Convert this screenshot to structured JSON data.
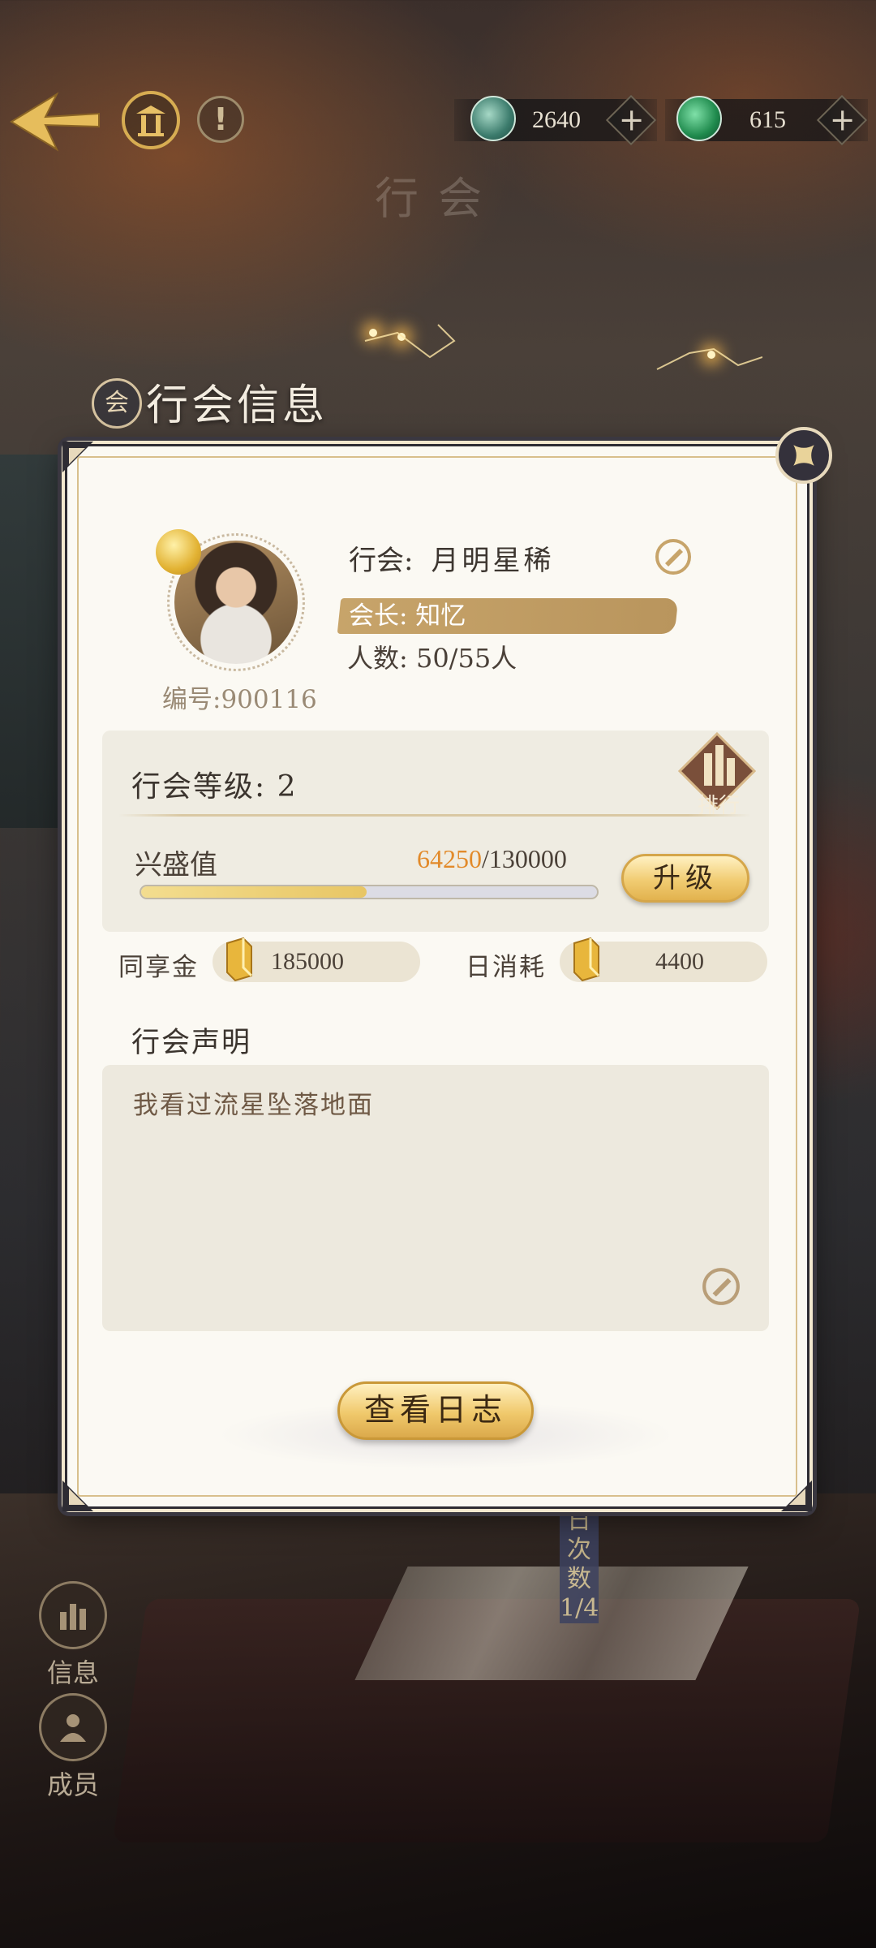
{
  "topbar": {
    "currencies": [
      {
        "icon": "jade-coin-icon",
        "value": "2640",
        "plus": "+"
      },
      {
        "icon": "jade-ring-icon",
        "value": "615",
        "plus": "+"
      }
    ],
    "info_glyph": "!"
  },
  "background": {
    "banner_title": "行会",
    "scroll_text": "日次数 1/4"
  },
  "panel": {
    "title": "行会信息",
    "title_icon_glyph": "会",
    "guild_label": "行会:",
    "guild_name": "月明星稀",
    "leader": "会长: 知忆",
    "member_count": "人数: 50/55人",
    "id_label": "编号:900116",
    "level_label": "行会等级: 2",
    "rank_label": "排行",
    "prosperity_label": "兴盛值",
    "prosperity_current": "64250",
    "prosperity_max": "/130000",
    "prosperity_progress": 0.494,
    "upgrade_button": "升级",
    "shared_fund_label": "同享金",
    "shared_fund_value": "185000",
    "daily_cost_label": "日消耗",
    "daily_cost_value": "4400",
    "declaration_title": "行会声明",
    "declaration_text": "我看过流星坠落地面",
    "log_button": "查看日志"
  },
  "side_nav": [
    {
      "icon": "info-icon",
      "label": "信息"
    },
    {
      "icon": "members-icon",
      "label": "成员"
    }
  ],
  "colors": {
    "accent_gold": "#d7ad52",
    "prosperity_current": "#e28a2a",
    "panel_bg": "#fbf9f3",
    "leader_bar": "#c7a46a"
  }
}
